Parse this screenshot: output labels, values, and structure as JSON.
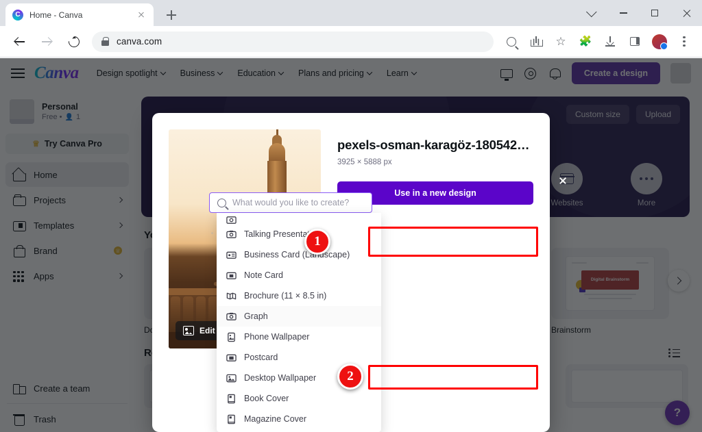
{
  "browser": {
    "tab_title": "Home - Canva",
    "favicon_letter": "C",
    "url": "canva.com",
    "new_tab_label": "+"
  },
  "canva_header": {
    "logo": "Canva",
    "nav": [
      {
        "label": "Design spotlight"
      },
      {
        "label": "Business"
      },
      {
        "label": "Education"
      },
      {
        "label": "Plans and pricing"
      },
      {
        "label": "Learn"
      }
    ],
    "create_button": "Create a design"
  },
  "sidebar": {
    "account_name": "Personal",
    "account_sub": "Free •",
    "account_members": "1",
    "pro_button": "Try Canva Pro",
    "items": [
      {
        "label": "Home",
        "icon": "home-icon",
        "active": true,
        "chevron": false,
        "badge": false
      },
      {
        "label": "Projects",
        "icon": "folder-icon",
        "active": false,
        "chevron": true,
        "badge": false
      },
      {
        "label": "Templates",
        "icon": "templates-icon",
        "active": false,
        "chevron": true,
        "badge": false
      },
      {
        "label": "Brand",
        "icon": "brand-icon",
        "active": false,
        "chevron": false,
        "badge": true
      },
      {
        "label": "Apps",
        "icon": "apps-icon",
        "active": false,
        "chevron": true,
        "badge": false
      }
    ],
    "bottom_items": [
      {
        "label": "Create a team",
        "icon": "team-icon"
      },
      {
        "label": "Trash",
        "icon": "trash-icon"
      }
    ]
  },
  "banner": {
    "custom_size": "Custom size",
    "upload": "Upload",
    "tiles": [
      {
        "label": "Websites",
        "icon": "website-icon"
      },
      {
        "label": "More",
        "icon": "more-dots-icon"
      }
    ],
    "background_color": "#1d1145"
  },
  "main": {
    "section_title": "You",
    "cards": [
      {
        "label": "Doc"
      },
      {
        "label": ""
      },
      {
        "label": ""
      },
      {
        "label": "Brainstorm",
        "thumb_text": "Digital Brainstorm"
      }
    ],
    "recent_title": "Recent designs",
    "help_label": "?"
  },
  "modal": {
    "title": "pexels-osman-karagöz-180542…",
    "dimensions": "3925 × 5888 px",
    "use_button": "Use in a new design",
    "edit_photo": "Edit photo"
  },
  "search": {
    "placeholder": "What would you like to create?",
    "value": ""
  },
  "dropdown": {
    "items": [
      {
        "label": "Talking Presentation",
        "icon": "presentation-icon",
        "highlight": false
      },
      {
        "label": "Business Card (Landscape)",
        "icon": "business-card-icon",
        "highlight": false
      },
      {
        "label": "Note Card",
        "icon": "note-card-icon",
        "highlight": false
      },
      {
        "label": "Brochure (11 × 8.5 in)",
        "icon": "brochure-icon",
        "highlight": false
      },
      {
        "label": "Graph",
        "icon": "graph-icon",
        "highlight": true
      },
      {
        "label": "Phone Wallpaper",
        "icon": "phone-wallpaper-icon",
        "highlight": false
      },
      {
        "label": "Postcard",
        "icon": "postcard-icon",
        "highlight": false
      },
      {
        "label": "Desktop Wallpaper",
        "icon": "desktop-wallpaper-icon",
        "highlight": false
      },
      {
        "label": "Book Cover",
        "icon": "book-cover-icon",
        "highlight": false
      },
      {
        "label": "Magazine Cover",
        "icon": "magazine-cover-icon",
        "highlight": false
      }
    ]
  },
  "annotations": {
    "badge_one": "1",
    "badge_two": "2",
    "highlight_color": "#ff0000"
  }
}
